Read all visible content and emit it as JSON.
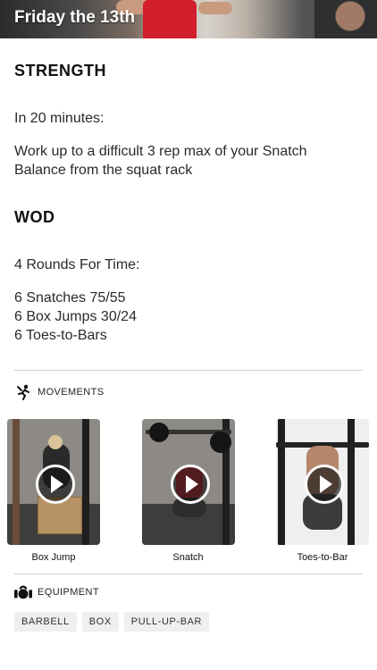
{
  "header": {
    "title": "Friday the 13th"
  },
  "strength": {
    "heading": "STRENGTH",
    "intro": "In 20 minutes:",
    "lines": [
      "Work up to a difficult 3 rep max of your Snatch",
      "Balance from the squat rack"
    ]
  },
  "wod": {
    "heading": "WOD",
    "intro": "4 Rounds For Time:",
    "items": [
      "6 Snatches 75/55",
      "6 Box Jumps 30/24",
      "6 Toes-to-Bars"
    ]
  },
  "movements": {
    "heading": "MOVEMENTS",
    "items": [
      {
        "label": "Box Jump"
      },
      {
        "label": "Snatch"
      },
      {
        "label": "Toes-to-Bar"
      }
    ]
  },
  "equipment": {
    "heading": "EQUIPMENT",
    "tags": [
      "BARBELL",
      "BOX",
      "PULL-UP-BAR"
    ]
  }
}
